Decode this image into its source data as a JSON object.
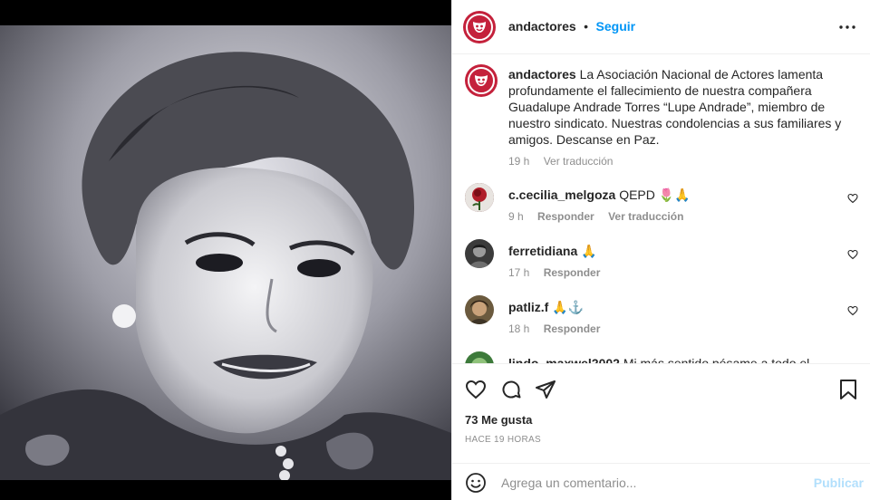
{
  "post": {
    "author": "andactores",
    "separator": "•",
    "follow_label": "Seguir",
    "more_icon": "more-horizontal-icon"
  },
  "caption": {
    "author": "andactores",
    "text": "La Asociación Nacional de Actores lamenta profundamente el fallecimiento de nuestra compañera Guadalupe Andrade Torres “Lupe Andrade”, miembro de nuestro sindicato. Nuestras condolencias a sus familiares y amigos. Descanse en Paz.",
    "time": "19 h",
    "translate": "Ver traducción"
  },
  "comments": [
    {
      "user": "c.cecilia_melgoza",
      "text": "QEPD 🌷🙏",
      "time": "9 h",
      "reply": "Responder",
      "translate": "Ver traducción"
    },
    {
      "user": "ferretidiana",
      "text": "🙏",
      "time": "17 h",
      "reply": "Responder"
    },
    {
      "user": "patliz.f",
      "text": "🙏⚓",
      "time": "18 h",
      "reply": "Responder"
    },
    {
      "user": "lindo_maxwel2002",
      "text": "Mi más sentido pésame a todo el equipo"
    }
  ],
  "actions": {
    "likes": "73 Me gusta",
    "time_ago": "HACE 19 HORAS"
  },
  "add_comment": {
    "placeholder": "Agrega un comentario...",
    "publish_label": "Publicar"
  },
  "colors": {
    "brand": "#c4213b",
    "link": "#0095f6",
    "muted": "#8e8e8e",
    "publish_disabled": "#b2dffc"
  }
}
